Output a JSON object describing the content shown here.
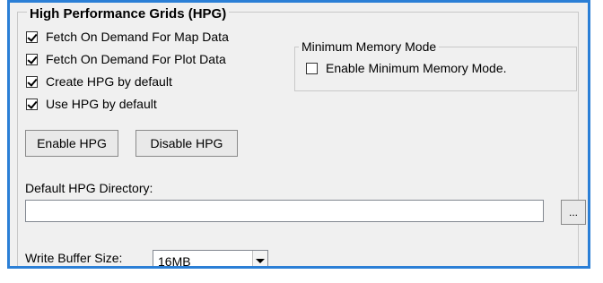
{
  "hpg_group": {
    "title": "High Performance Grids (HPG)",
    "checkboxes": [
      {
        "label": "Fetch On Demand For Map Data",
        "checked": true
      },
      {
        "label": "Fetch On Demand For Plot Data",
        "checked": true
      },
      {
        "label": "Create HPG by default",
        "checked": true
      },
      {
        "label": "Use HPG by default",
        "checked": true
      }
    ],
    "enable_button": "Enable HPG",
    "disable_button": "Disable HPG",
    "directory_label": "Default HPG Directory:",
    "directory_value": "",
    "browse_button": "...",
    "write_buffer_label": "Write Buffer Size:",
    "write_buffer_value": "16MB"
  },
  "memory_group": {
    "title": "Minimum Memory Mode",
    "checkbox": {
      "label": "Enable Minimum Memory Mode.",
      "checked": false
    }
  },
  "colors": {
    "accent_border": "#2b7fd6",
    "panel_bg": "#f0f0f0"
  },
  "icons": {
    "dropdown": "chevron-down-icon",
    "check": "checkmark-icon"
  }
}
